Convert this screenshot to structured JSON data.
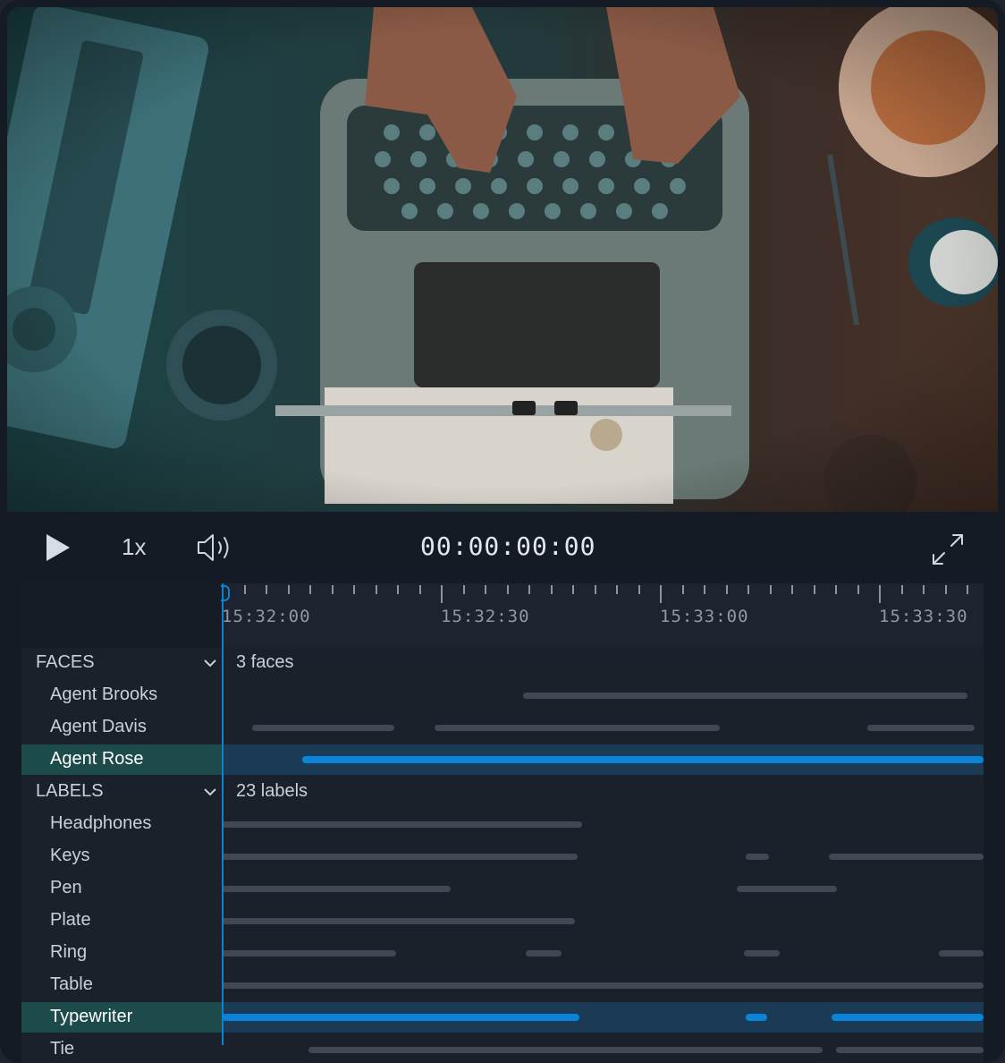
{
  "player": {
    "speed_label": "1x",
    "timecode": "00:00:00:00",
    "play_icon": "play-icon",
    "volume_icon": "volume-icon",
    "fullscreen_icon": "fullscreen-icon"
  },
  "colors": {
    "accent": "#0a84d6",
    "selected_label_bg": "#1d4a4a",
    "selected_track_bg": "#1a3a56",
    "bar_default": "#414854",
    "background": "#151b25"
  },
  "ruler": {
    "labels": [
      "15:32:00",
      "15:32:30",
      "15:33:00",
      "15:33:30"
    ]
  },
  "faces": {
    "title": "FACES",
    "count": "3 faces",
    "items": [
      {
        "label": "Agent Brooks",
        "selected": false,
        "segments": [
          [
            0.395,
            0.979
          ]
        ]
      },
      {
        "label": "Agent Davis",
        "selected": false,
        "segments": [
          [
            0.04,
            0.227
          ],
          [
            0.279,
            0.654
          ],
          [
            0.847,
            0.988
          ]
        ]
      },
      {
        "label": "Agent Rose",
        "selected": true,
        "segments": [
          [
            0.106,
            1.0
          ]
        ]
      }
    ]
  },
  "labels": {
    "title": "LABELS",
    "count": "23 labels",
    "items": [
      {
        "label": "Headphones",
        "selected": false,
        "segments": [
          [
            0.0,
            0.473
          ]
        ]
      },
      {
        "label": "Keys",
        "selected": false,
        "segments": [
          [
            0.0,
            0.467
          ],
          [
            0.688,
            0.718
          ],
          [
            0.797,
            1.0
          ]
        ]
      },
      {
        "label": "Pen",
        "selected": false,
        "segments": [
          [
            0.0,
            0.3
          ],
          [
            0.676,
            0.808
          ]
        ]
      },
      {
        "label": "Plate",
        "selected": false,
        "segments": [
          [
            0.0,
            0.464
          ]
        ]
      },
      {
        "label": "Ring",
        "selected": false,
        "segments": [
          [
            0.0,
            0.229
          ],
          [
            0.399,
            0.446
          ],
          [
            0.685,
            0.732
          ],
          [
            0.941,
            1.0
          ]
        ]
      },
      {
        "label": "Table",
        "selected": false,
        "segments": [
          [
            0.0,
            1.0
          ]
        ]
      },
      {
        "label": "Typewriter",
        "selected": true,
        "segments": [
          [
            0.0,
            0.469
          ],
          [
            0.688,
            0.716
          ],
          [
            0.801,
            1.0
          ]
        ]
      },
      {
        "label": "Tie",
        "selected": false,
        "segments": [
          [
            0.114,
            0.789
          ],
          [
            0.806,
            1.0
          ]
        ]
      }
    ]
  }
}
